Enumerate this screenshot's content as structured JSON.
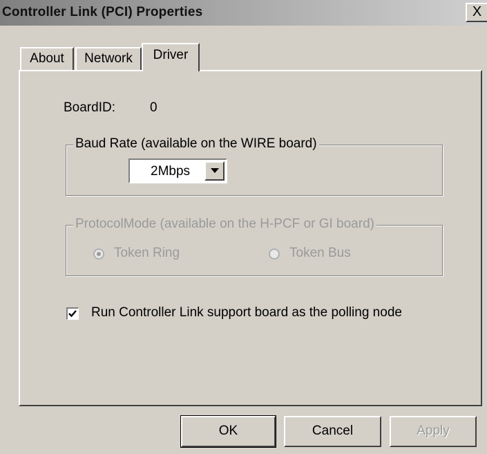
{
  "window": {
    "title": "Controller Link (PCI) Properties",
    "close_glyph": "X"
  },
  "tabs": [
    {
      "label": "About",
      "active": false
    },
    {
      "label": "Network",
      "active": false
    },
    {
      "label": "Driver",
      "active": true
    }
  ],
  "driver": {
    "board_id_label": "BoardID:",
    "board_id_value": "0",
    "baud_group_label": "Baud Rate (available on the WIRE board)",
    "baud_rate_value": "2Mbps",
    "protocol_group_label": "ProtocolMode (available on the H-PCF or GI board)",
    "protocol_options": [
      {
        "label": "Token Ring",
        "selected": true,
        "enabled": false
      },
      {
        "label": "Token Bus",
        "selected": false,
        "enabled": false
      }
    ],
    "polling_checkbox_label": "Run Controller Link support board as the polling node",
    "polling_checked": true
  },
  "buttons": {
    "ok": "OK",
    "cancel": "Cancel",
    "apply": "Apply"
  },
  "icons": {
    "close": "close-icon",
    "dropdown": "chevron-down-icon",
    "check": "checkmark-icon"
  },
  "colors": {
    "face": "#d4d0c8",
    "title_gradient_start": "#808080",
    "disabled_text": "#9a9a9a"
  }
}
